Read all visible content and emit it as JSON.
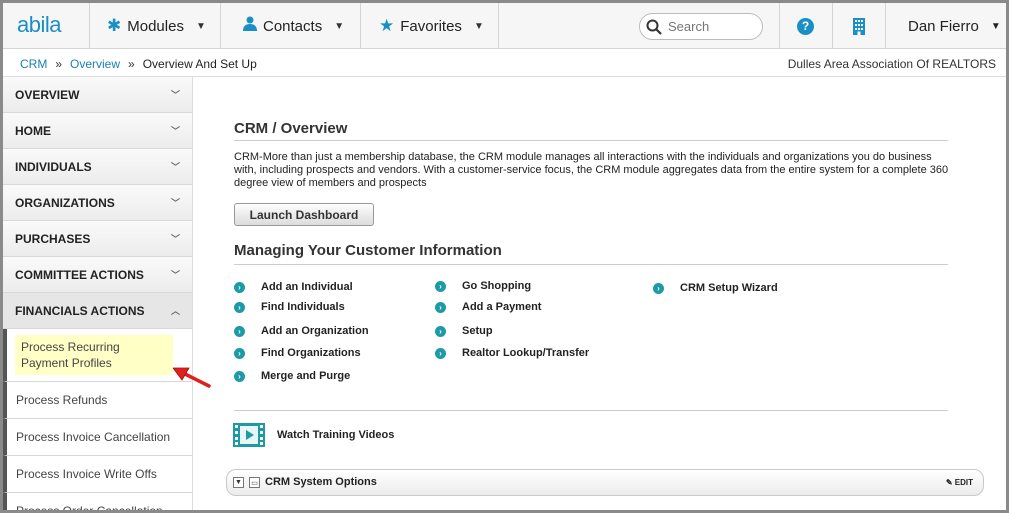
{
  "app": {
    "logo": "abila"
  },
  "nav": {
    "modules": "Modules",
    "contacts": "Contacts",
    "favorites": "Favorites",
    "search_placeholder": "Search",
    "user": "Dan Fierro"
  },
  "breadcrumb": {
    "crumb1": "CRM",
    "crumb2": "Overview",
    "crumb3": "Overview And Set Up",
    "sep": "»",
    "organization": "Dulles Area Association Of REALTORS"
  },
  "sidebar": {
    "sections": [
      {
        "label": "OVERVIEW"
      },
      {
        "label": "HOME"
      },
      {
        "label": "INDIVIDUALS"
      },
      {
        "label": "ORGANIZATIONS"
      },
      {
        "label": "PURCHASES"
      },
      {
        "label": "COMMITTEE ACTIONS"
      },
      {
        "label": "FINANCIALS ACTIONS"
      }
    ],
    "sub_items": [
      {
        "label": "Process Recurring Payment Profiles"
      },
      {
        "label": "Process Refunds"
      },
      {
        "label": "Process Invoice Cancellation"
      },
      {
        "label": "Process Invoice Write Offs"
      },
      {
        "label": "Process Order Cancellation"
      }
    ]
  },
  "main": {
    "title": "CRM / Overview",
    "description": "CRM-More than just a membership database, the CRM module manages all interactions with the individuals and organizations you do business with, including prospects and vendors. With a customer-service focus, the CRM module aggregates data from the entire system for a complete 360 degree view of members and prospects",
    "launch_button": "Launch Dashboard",
    "section_title": "Managing Your Customer Information",
    "links": {
      "col1": [
        "Add an Individual",
        "Find Individuals",
        "Add an Organization",
        "Find Organizations",
        "Merge and Purge"
      ],
      "col2": [
        "Go Shopping",
        "Add a Payment",
        "Setup",
        "Realtor Lookup/Transfer"
      ],
      "col3": [
        "CRM Setup Wizard"
      ]
    },
    "video_label": "Watch Training Videos",
    "options_title": "CRM System Options",
    "edit_label": "EDIT"
  },
  "colors": {
    "accent": "#1a8fc6",
    "link_dot": "#1c9aa6",
    "highlight": "#ffffc6",
    "arrow": "#e02020"
  }
}
